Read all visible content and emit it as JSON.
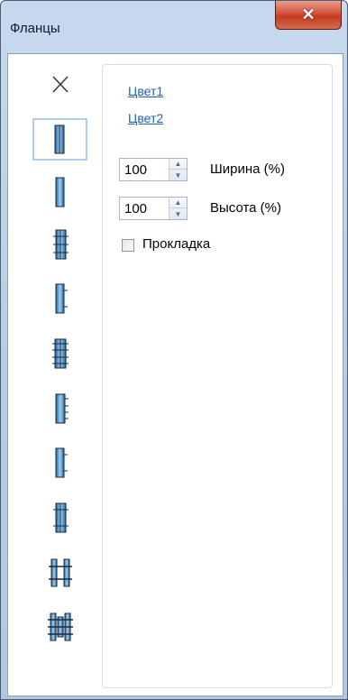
{
  "window": {
    "title": "Фланцы"
  },
  "links": {
    "color1": "Цвет1",
    "color2": "Цвет2"
  },
  "fields": {
    "width_value": "100",
    "width_label": "Ширина (%)",
    "height_value": "100",
    "height_label": "Высота (%)"
  },
  "gasket": {
    "label": "Прокладка",
    "checked": false
  },
  "flange_icons": [
    "none-icon",
    "flange-double-icon",
    "flange-single-icon",
    "flange-bolted-icon",
    "flange-half-icon",
    "flange-bolted-double-icon",
    "flange-half-bolted-icon",
    "flange-half-plain-icon",
    "flange-narrow-bolted-icon",
    "flange-pair-icon",
    "flange-pair-gasket-icon"
  ],
  "colors": {
    "flange_gradient": [
      "#1f5f9e",
      "#9fd2f0",
      "#1f5f9e"
    ],
    "accent": "#2062b8"
  }
}
